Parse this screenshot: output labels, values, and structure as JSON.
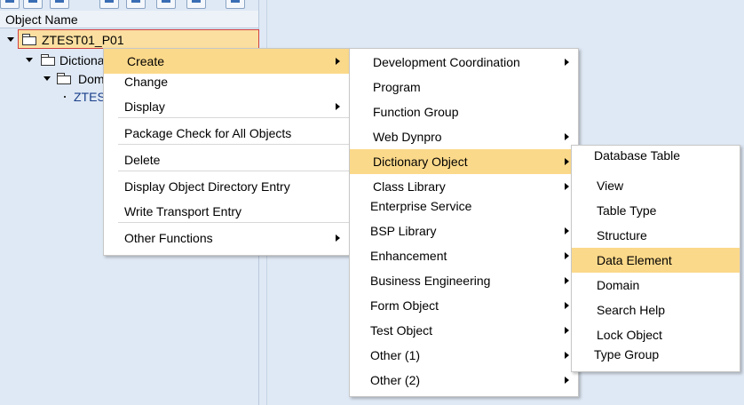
{
  "tree": {
    "column_header": "Object Name",
    "rows": [
      {
        "label": "ZTEST01_P01"
      },
      {
        "label": "Dictiona"
      },
      {
        "label": "Dom"
      },
      {
        "label": "ZTES"
      }
    ]
  },
  "context_menu": {
    "items": [
      {
        "label": "Create",
        "submenu": true,
        "highlighted": true
      },
      {
        "label": "Change"
      },
      {
        "label": "Display",
        "submenu": true
      },
      {
        "label": "Package Check for All Objects"
      },
      {
        "label": "Delete"
      },
      {
        "label": "Display Object Directory Entry"
      },
      {
        "label": "Write Transport Entry"
      },
      {
        "label": "Other Functions",
        "submenu": true
      }
    ]
  },
  "create_menu": {
    "items": [
      {
        "label": "Development Coordination",
        "submenu": true
      },
      {
        "label": "Program"
      },
      {
        "label": "Function Group"
      },
      {
        "label": "Web Dynpro",
        "submenu": true
      },
      {
        "label": "Dictionary Object",
        "submenu": true,
        "highlighted": true
      },
      {
        "label": "Class Library",
        "submenu": true
      },
      {
        "label": "Enterprise Service"
      },
      {
        "label": "BSP Library",
        "submenu": true
      },
      {
        "label": "Enhancement",
        "submenu": true
      },
      {
        "label": "Business Engineering",
        "submenu": true
      },
      {
        "label": "Form Object",
        "submenu": true
      },
      {
        "label": "Test Object",
        "submenu": true
      },
      {
        "label": "Other (1)",
        "submenu": true
      },
      {
        "label": "Other (2)",
        "submenu": true
      }
    ]
  },
  "dictionary_menu": {
    "items": [
      {
        "label": "Database Table"
      },
      {
        "label": "View"
      },
      {
        "label": "Table Type"
      },
      {
        "label": "Structure"
      },
      {
        "label": "Data Element",
        "highlighted": true
      },
      {
        "label": "Domain"
      },
      {
        "label": "Search Help"
      },
      {
        "label": "Lock Object"
      },
      {
        "label": "Type Group"
      }
    ]
  },
  "colors": {
    "highlight": "#fbd98a",
    "background": "#dfe9f5",
    "selection_border": "#d04040"
  }
}
